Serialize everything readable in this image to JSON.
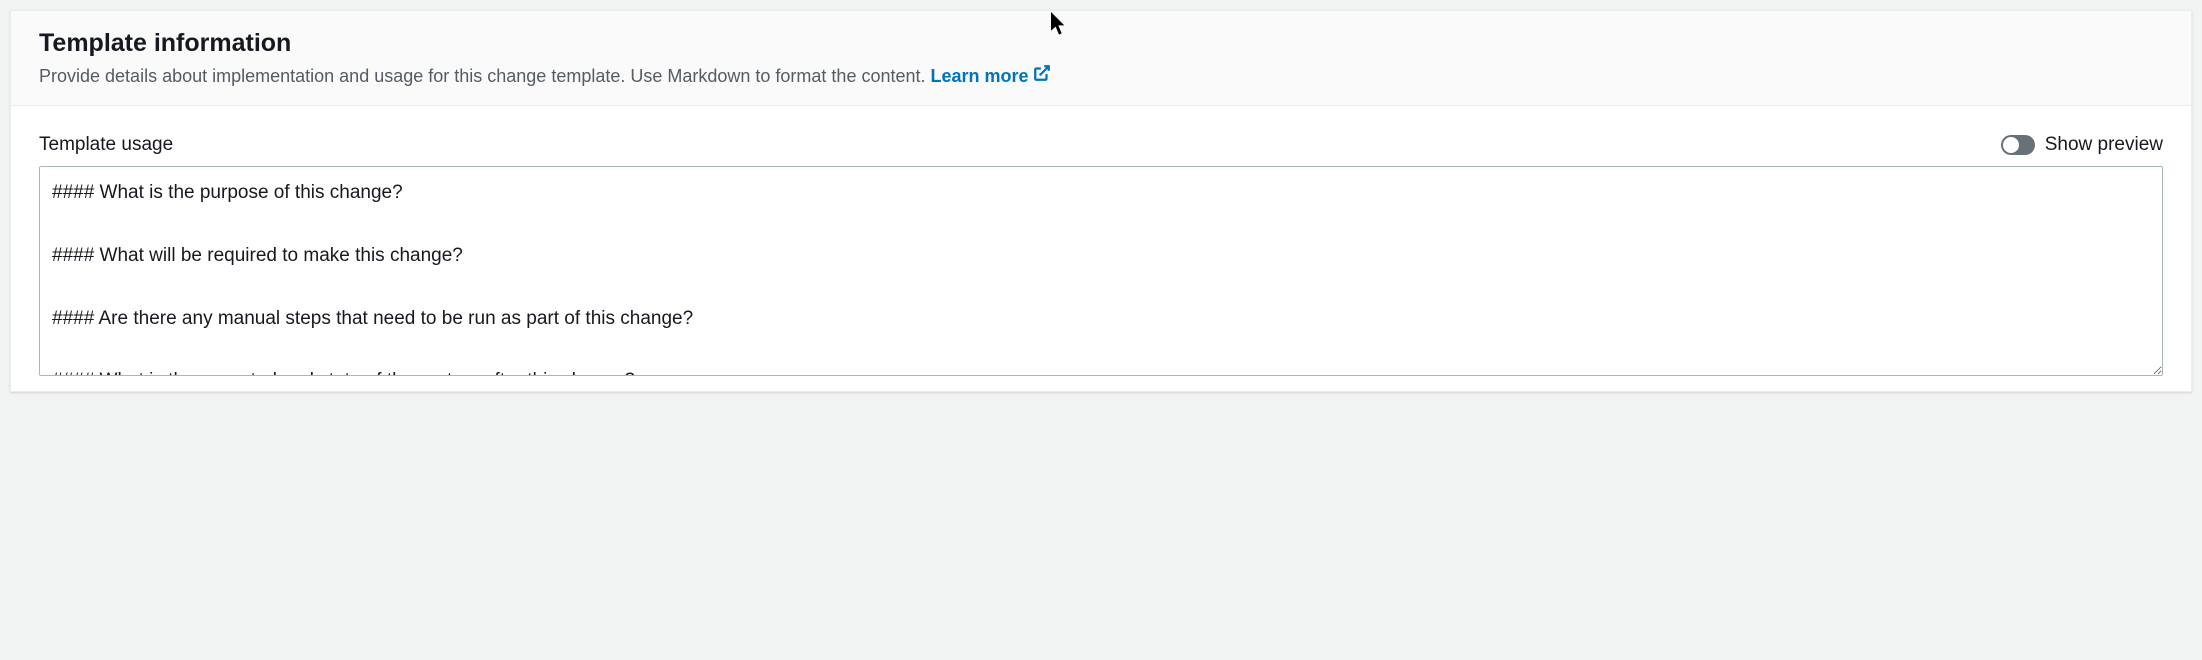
{
  "header": {
    "title": "Template information",
    "description": "Provide details about implementation and usage for this change template. Use Markdown to format the content. ",
    "learn_more": "Learn more"
  },
  "form": {
    "usage_label": "Template usage",
    "preview_label": "Show preview",
    "textarea_value": "#### What is the purpose of this change?\n\n#### What will be required to make this change?\n\n#### Are there any manual steps that need to be run as part of this change?\n\n#### What is the expected end state of the system after this change?"
  }
}
